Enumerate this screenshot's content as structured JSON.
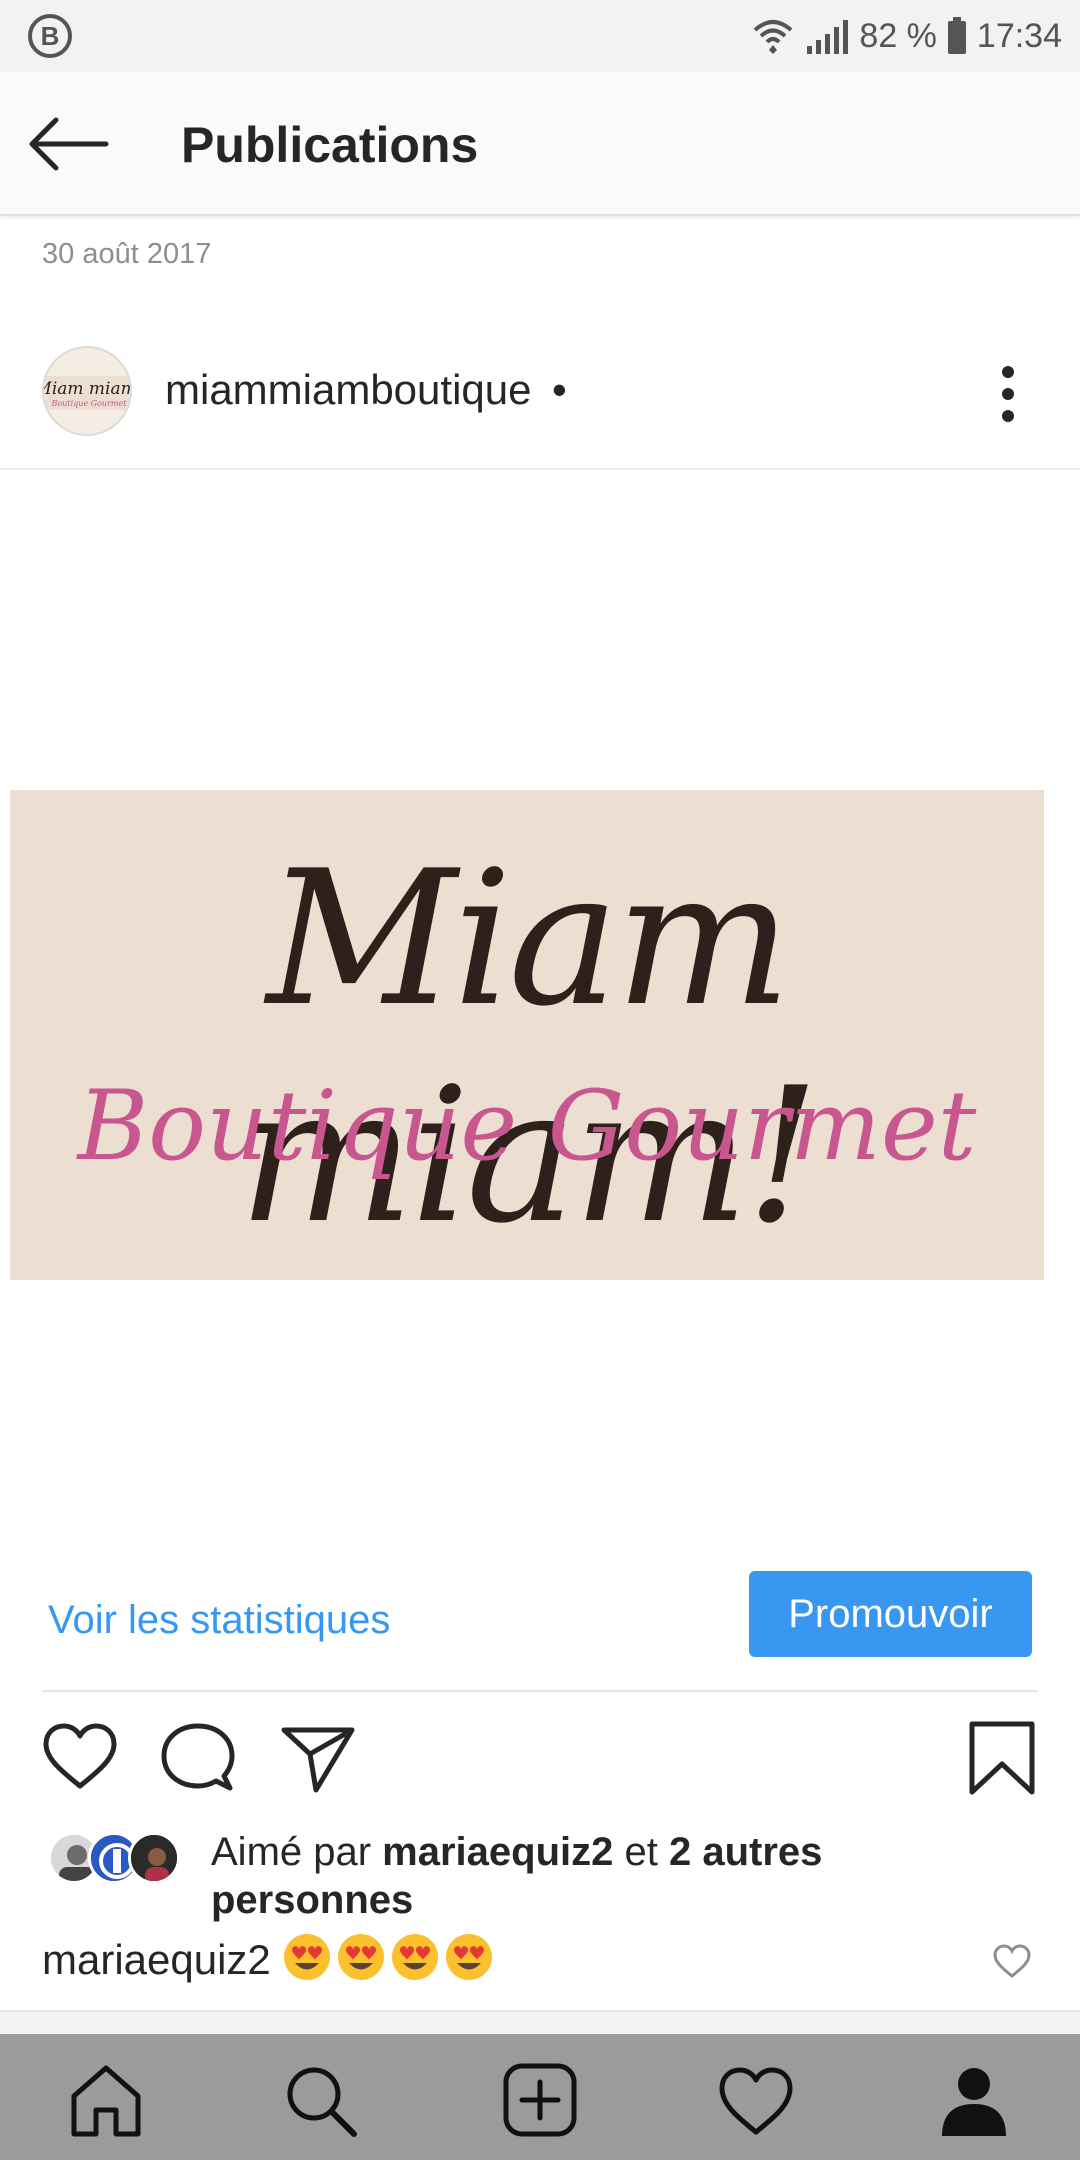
{
  "status_bar": {
    "badge": "B",
    "battery": "82 %",
    "time": "17:34"
  },
  "header": {
    "title": "Publications"
  },
  "post": {
    "date": "30 août 2017",
    "username": "miammiamboutique",
    "username_dot": "•",
    "image": {
      "logo_main": "Miam miam!",
      "logo_sub": "Boutique Gourmet",
      "avatar_logo": "Miam miam!",
      "avatar_sub": "Boutique Gourmet"
    },
    "insights_label": "Voir les statistiques",
    "promote_label": "Promouvoir",
    "likes": {
      "prefix": "Aimé par ",
      "user": "mariaequiz2",
      "mid": " et ",
      "others": "2 autres personnes"
    },
    "comment": {
      "user": "mariaequiz2",
      "emojis": [
        "😍",
        "😍",
        "😍",
        "😍"
      ]
    }
  },
  "colors": {
    "accent": "#3897f0",
    "logo_bg": "#ecdfd2",
    "logo_dark": "#2e211c",
    "logo_pink": "#c9578f",
    "nav_bg": "#9b9b9b"
  },
  "icons": {
    "actions": [
      "heart-icon",
      "comment-icon",
      "share-icon",
      "bookmark-icon"
    ],
    "nav": [
      "home-icon",
      "search-icon",
      "add-post-icon",
      "activity-icon",
      "profile-icon"
    ]
  }
}
